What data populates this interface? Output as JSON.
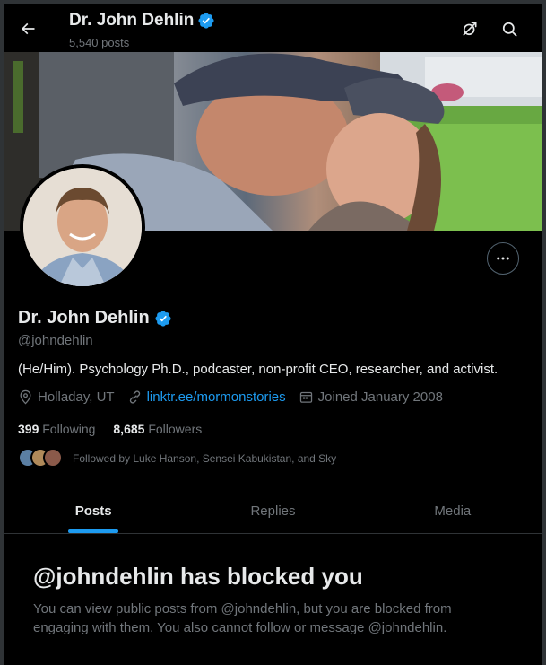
{
  "header": {
    "name": "Dr. John Dehlin",
    "post_count": "5,540 posts"
  },
  "profile": {
    "name": "Dr. John Dehlin",
    "handle": "@johndehlin",
    "bio": "(He/Him). Psychology Ph.D., podcaster, non-profit CEO, researcher, and activist.",
    "location": "Holladay, UT",
    "website": "linktr.ee/mormonstories",
    "joined": "Joined January 2008",
    "following_count": "399",
    "following_label": "Following",
    "followers_count": "8,685",
    "followers_label": "Followers",
    "followed_by": "Followed by Luke Hanson, Sensei Kabukistan, and Sky"
  },
  "tabs": [
    {
      "label": "Posts",
      "active": true
    },
    {
      "label": "Replies",
      "active": false
    },
    {
      "label": "Media",
      "active": false
    }
  ],
  "blocked": {
    "title": "@johndehlin has blocked you",
    "message": "You can view public posts from @johndehlin, but you are blocked from engaging with them. You also cannot follow or message @johndehlin."
  },
  "icons": {
    "back": "arrow-left-icon",
    "grok": "grok-icon",
    "search": "search-icon",
    "more": "more-icon",
    "verified": "verified-badge-icon",
    "location": "location-pin-icon",
    "link": "link-icon",
    "calendar": "calendar-icon"
  },
  "colors": {
    "accent": "#1d9bf0",
    "background": "#000000",
    "text_primary": "#e7e9ea",
    "text_secondary": "#71767b"
  }
}
